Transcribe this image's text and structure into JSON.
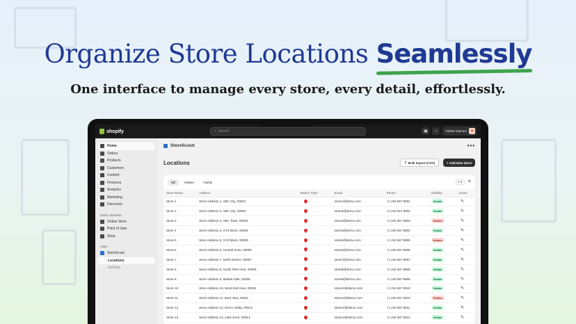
{
  "headline": {
    "main": "Organize Store Locations ",
    "highlight": "Seamlessly"
  },
  "subheadline": "One interface to manage every store, every detail, effortlessly.",
  "topbar": {
    "brand": "shopify",
    "search_placeholder": "Search",
    "store_name": "Global Interiors"
  },
  "sidebar": {
    "items": [
      {
        "label": "Home",
        "icon": "home-icon",
        "active": true
      },
      {
        "label": "Orders",
        "icon": "orders-icon"
      },
      {
        "label": "Products",
        "icon": "products-icon"
      },
      {
        "label": "Customers",
        "icon": "customers-icon"
      },
      {
        "label": "Content",
        "icon": "content-icon"
      },
      {
        "label": "Finances",
        "icon": "finances-icon"
      },
      {
        "label": "Analytics",
        "icon": "analytics-icon"
      },
      {
        "label": "Marketing",
        "icon": "marketing-icon"
      },
      {
        "label": "Discounts",
        "icon": "discounts-icon"
      }
    ],
    "sales_channels_heading": "Sales channels",
    "sales_channels": [
      {
        "label": "Online Store",
        "icon": "online-store-icon"
      },
      {
        "label": "Point of Sale",
        "icon": "pos-icon"
      },
      {
        "label": "Shop",
        "icon": "shop-icon"
      }
    ],
    "apps_heading": "Apps",
    "app_name": "StoreScout",
    "app_sub": [
      {
        "label": "Locations",
        "active": true
      },
      {
        "label": "Settings"
      }
    ]
  },
  "app_header": {
    "name": "StoreScout",
    "more": "•••"
  },
  "page": {
    "title": "Locations",
    "bulk_import": "Bulk Import (CSV)",
    "add_store": "+ Add New Store"
  },
  "tabs": [
    "All",
    "Hidden",
    "Visible"
  ],
  "columns": [
    "Store Name",
    "Address",
    "Marker Style",
    "Email",
    "Phone",
    "Visibility",
    "Action"
  ],
  "rows": [
    {
      "name": "Store 1",
      "address": "Store Address 1, ABC City, 00001",
      "email": "store1@demo.com",
      "phone": "+1 234 567 8901",
      "visibility": "Visible"
    },
    {
      "name": "Store 2",
      "address": "Store Address 2, ABC City, 00002",
      "email": "store2@demo.com",
      "phone": "+1 234 567 8902",
      "visibility": "Visible"
    },
    {
      "name": "Store 3",
      "address": "Store Address 3, ABC Town, 00003",
      "email": "store3@demo.com",
      "phone": "+1 234 567 8903",
      "visibility": "Hidden"
    },
    {
      "name": "Store 4",
      "address": "Store Address 4, XYZ Block, 00004",
      "email": "store4@demo.com",
      "phone": "+1 234 567 8904",
      "visibility": "Visible"
    },
    {
      "name": "Store 5",
      "address": "Store Address 5, XYZ Block, 00005",
      "email": "store5@demo.com",
      "phone": "+1 234 567 8905",
      "visibility": "Hidden"
    },
    {
      "name": "Store 6",
      "address": "Store Address 6, Central Zone, 00006",
      "email": "store6@demo.com",
      "phone": "+1 234 567 8906",
      "visibility": "Visible"
    },
    {
      "name": "Store 7",
      "address": "Store Address 7, North District, 00007",
      "email": "store7@demo.com",
      "phone": "+1 234 567 8907",
      "visibility": "Visible"
    },
    {
      "name": "Store 8",
      "address": "Store Address 8, South Park Area, 00008",
      "email": "store8@demo.com",
      "phone": "+1 234 567 8908",
      "visibility": "Visible"
    },
    {
      "name": "Store 9",
      "address": "Store Address 9, Market Side, 00009",
      "email": "store9@demo.com",
      "phone": "+1 234 567 8909",
      "visibility": "Visible"
    },
    {
      "name": "Store 10",
      "address": "Store Address 10, West End Area, 00010",
      "email": "store10@demo.com",
      "phone": "+1 234 567 8910",
      "visibility": "Visible"
    },
    {
      "name": "Store 11",
      "address": "Store Address 11, East View, 00011",
      "email": "store11@demo.com",
      "phone": "+1 234 567 8910",
      "visibility": "Hidden"
    },
    {
      "name": "Store 12",
      "address": "Store Address 12, Demo Valley, 00012",
      "email": "store12@demo.com",
      "phone": "+1 234 567 8911",
      "visibility": "Visible"
    },
    {
      "name": "Store 13",
      "address": "Store Address 13, Lake Zone, 00013",
      "email": "store13@demo.com",
      "phone": "+1 234 567 8912",
      "visibility": "Visible"
    }
  ],
  "colors": {
    "headline": "#1f3a93",
    "accent_green": "#3fa34d",
    "visible_badge": "#cdfee1",
    "hidden_badge": "#fedad9",
    "marker": "#e02b27"
  }
}
